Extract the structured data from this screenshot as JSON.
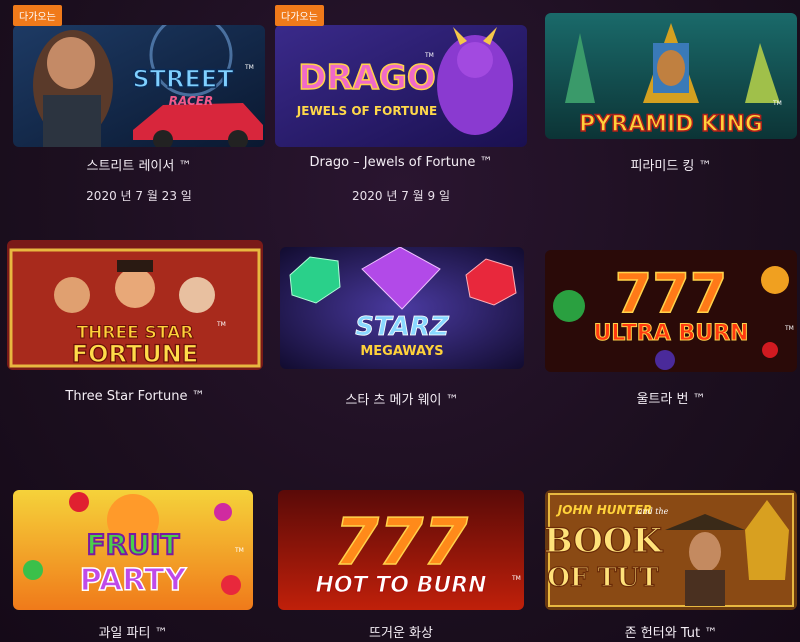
{
  "games": [
    {
      "badge": "다가오는",
      "title": "스트리트 레이서 ™",
      "date": "2020 년 7 월 23 일",
      "logo_line1": "STREET",
      "logo_line2": "RACER",
      "tm": "TM"
    },
    {
      "badge": "다가오는",
      "title": "Drago – Jewels of Fortune ™",
      "date": "2020 년 7 월 9 일",
      "logo_line1": "DRAGO",
      "logo_line2": "JEWELS OF FORTUNE",
      "tm": "TM"
    },
    {
      "title": "피라미드 킹 ™",
      "logo_line1": "PYRAMID KING",
      "tm": "TM"
    },
    {
      "title": "Three Star Fortune ™",
      "logo_line1": "THREE STAR",
      "logo_line2": "FORTUNE",
      "tm": "TM"
    },
    {
      "title": "스타 츠 메가 웨이 ™",
      "logo_line1": "STARZ",
      "logo_line2": "MEGAWAYS",
      "tm": "TM"
    },
    {
      "title": "울트라 번 ™",
      "logo_line1": "777",
      "logo_line2": "ULTRA BURN",
      "tm": "TM"
    },
    {
      "title": "과일 파티 ™",
      "logo_line1": "FRUIT",
      "logo_line2": "PARTY",
      "tm": "TM"
    },
    {
      "title": "뜨거운 화상",
      "logo_line1": "777",
      "logo_line2": "HOT TO BURN",
      "tm": "TM"
    },
    {
      "title": "존 헌터와 Tut ™",
      "logo_line1": "JOHN HUNTER",
      "logo_line_small": "and the",
      "logo_line2": "BOOK",
      "logo_line3": "OF TUT"
    }
  ],
  "colors": {
    "background": "#1c0f1f",
    "badge": "#f07a1a",
    "text": "#f4eef5"
  }
}
